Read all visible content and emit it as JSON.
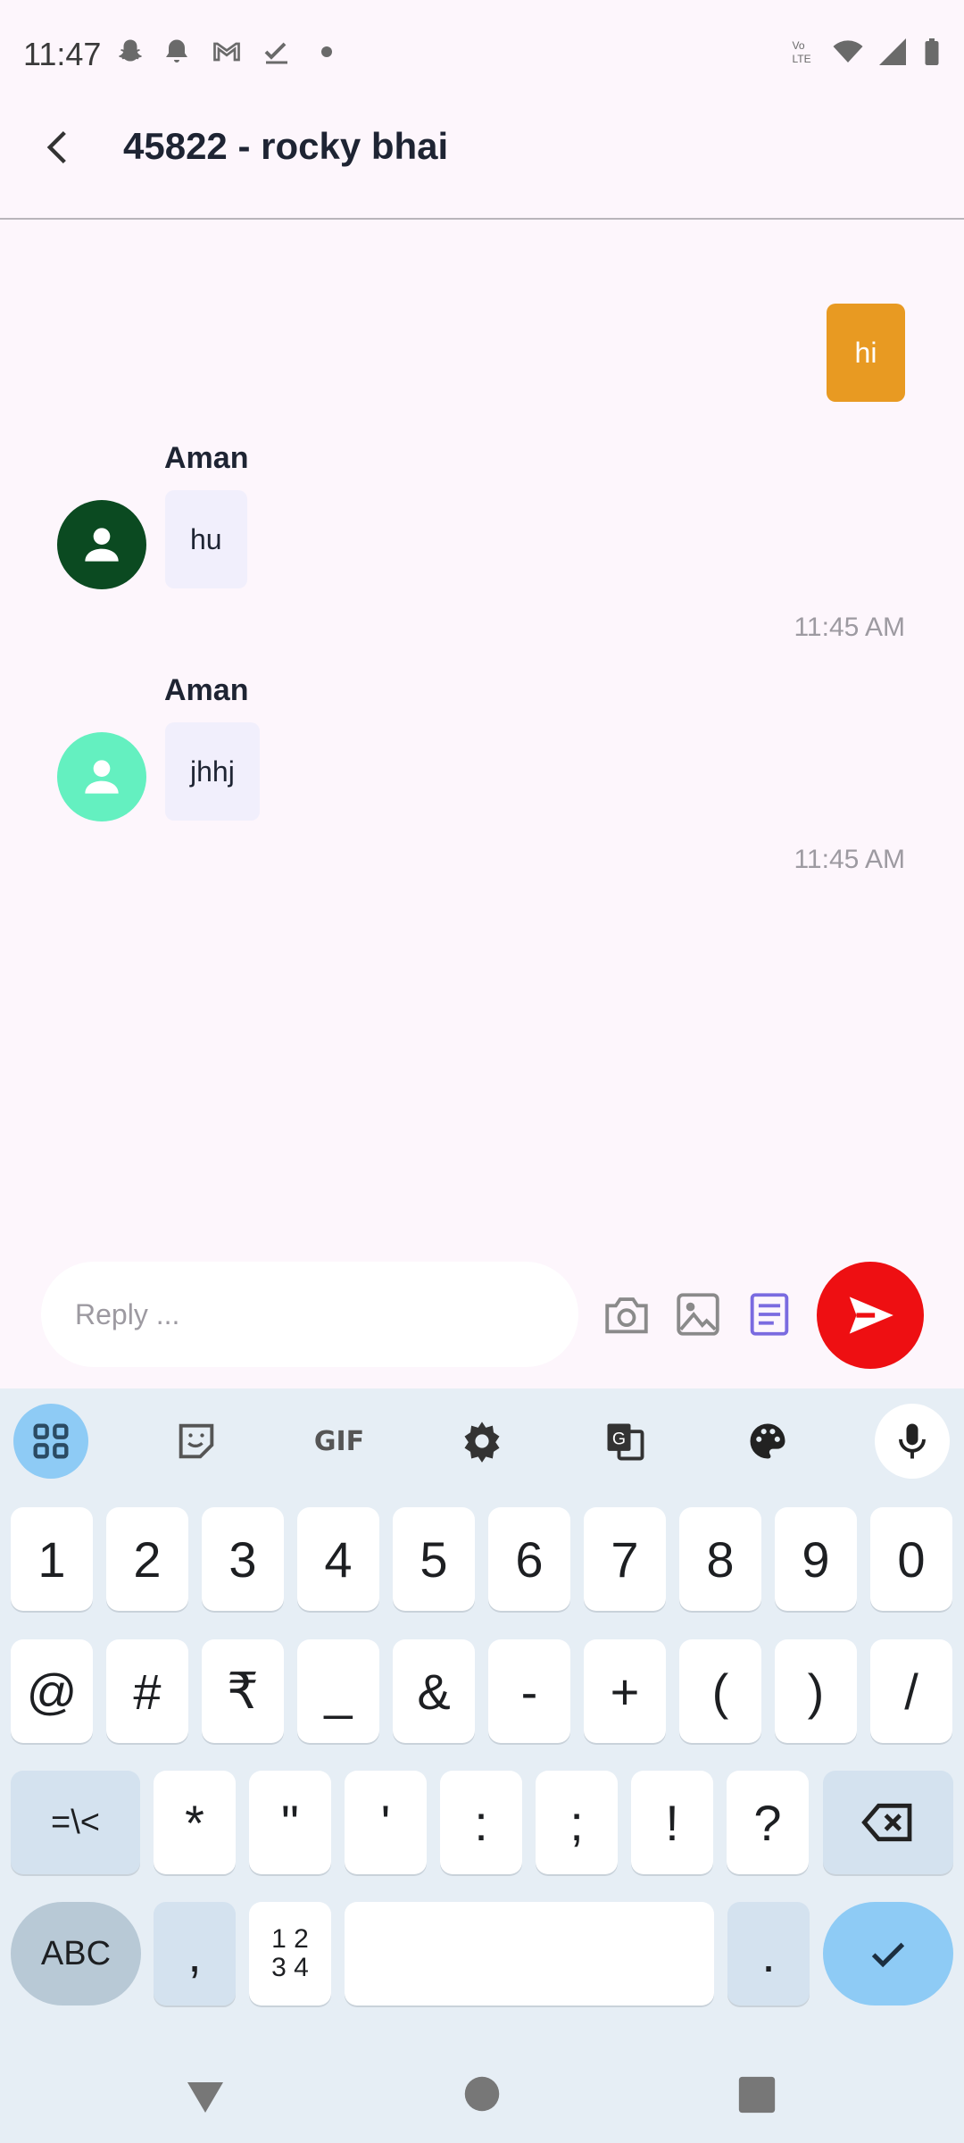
{
  "status_bar": {
    "time": "11:47",
    "left_icons": [
      "snapchat-icon",
      "notification-bell-icon",
      "gmail-icon",
      "task-check-icon",
      "dot-icon"
    ],
    "right_icons": [
      "volte-icon",
      "wifi-icon",
      "signal-icon",
      "battery-icon"
    ],
    "volte_text": "Vo LTE"
  },
  "header": {
    "title": "45822 - rocky bhai"
  },
  "messages": [
    {
      "direction": "out",
      "text": "hi",
      "color": "#e89a22"
    },
    {
      "direction": "in",
      "sender": "Aman",
      "text": "hu",
      "timestamp": "11:45 AM",
      "avatar_color": "#0b4a21"
    },
    {
      "direction": "in",
      "sender": "Aman",
      "text": "jhhj",
      "timestamp": "11:45 AM",
      "avatar_color": "#64f0c0"
    }
  ],
  "composer": {
    "placeholder": "Reply ...",
    "tools": [
      "camera-icon",
      "gallery-icon",
      "document-icon",
      "send-icon"
    ],
    "send_color": "#ee0f12"
  },
  "keyboard": {
    "toolbar": [
      "apps-grid-icon",
      "sticker-icon",
      "gif-icon",
      "settings-icon",
      "translate-icon",
      "palette-icon",
      "microphone-icon"
    ],
    "gif_label": "GIF",
    "row1": [
      "1",
      "2",
      "3",
      "4",
      "5",
      "6",
      "7",
      "8",
      "9",
      "0"
    ],
    "row2": [
      "@",
      "#",
      "₹",
      "_",
      "&",
      "-",
      "+",
      "(",
      ")",
      "/"
    ],
    "row3": {
      "mode": "=\\<",
      "keys": [
        "*",
        "\"",
        "'",
        ":",
        ";",
        "!",
        "?"
      ],
      "backspace": "backspace-icon"
    },
    "row4": {
      "abc": "ABC",
      "comma": ",",
      "numpad": "1 2\n3 4",
      "space": "",
      "period": ".",
      "enter": "check-icon"
    }
  },
  "nav_bar": [
    "back-triangle-icon",
    "home-circle-icon",
    "recents-square-icon"
  ]
}
